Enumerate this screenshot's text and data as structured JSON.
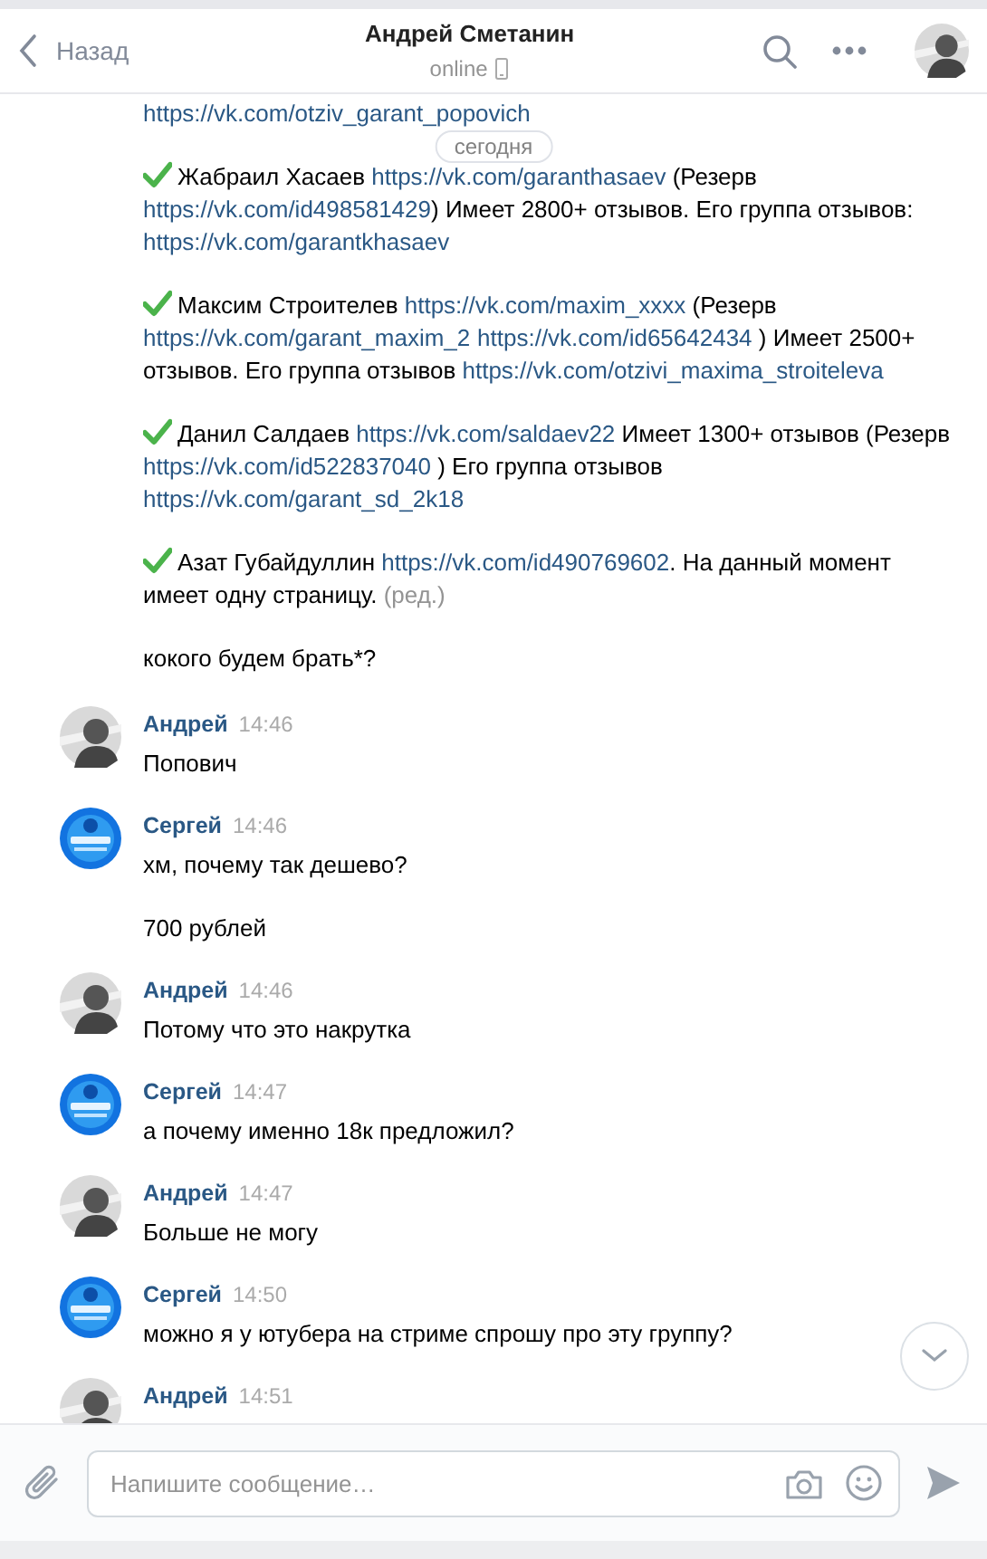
{
  "header": {
    "back_label": "Назад",
    "title": "Андрей Сметанин",
    "status": "online"
  },
  "date_divider": "сегодня",
  "messages": [
    {
      "paragraphs": [
        {
          "checked": false,
          "segments": [
            {
              "kind": "link",
              "text": "https://vk.com/otziv_garant_popovich"
            }
          ]
        },
        {
          "checked": true,
          "segments": [
            {
              "kind": "text",
              "text": "Жабраил Хасаев "
            },
            {
              "kind": "link",
              "text": "https://vk.com/garanthasaev"
            },
            {
              "kind": "text",
              "text": " (Резерв "
            },
            {
              "kind": "link",
              "text": "https://vk.com/id498581429"
            },
            {
              "kind": "text",
              "text": ") Имеет 2800+ отзывов. Его группа отзывов: "
            },
            {
              "kind": "link",
              "text": "https://vk.com/garantkhasaev"
            }
          ]
        },
        {
          "checked": true,
          "segments": [
            {
              "kind": "text",
              "text": "Максим Строителев "
            },
            {
              "kind": "link",
              "text": "https://vk.com/maxim_xxxx"
            },
            {
              "kind": "text",
              "text": " (Резерв "
            },
            {
              "kind": "link",
              "text": "https://vk.com/garant_maxim_2"
            },
            {
              "kind": "link",
              "text": "https://vk.com/id65642434"
            },
            {
              "kind": "text",
              "text": " ) Имеет 2500+ отзывов. Его группа отзывов "
            },
            {
              "kind": "link",
              "text": "https://vk.com/otzivi_maxima_stroiteleva"
            }
          ]
        },
        {
          "checked": true,
          "segments": [
            {
              "kind": "text",
              "text": "Данил Салдаев "
            },
            {
              "kind": "link",
              "text": "https://vk.com/saldaev22"
            },
            {
              "kind": "text",
              "text": " Имеет 1300+ отзывов (Резерв "
            },
            {
              "kind": "link",
              "text": "https://vk.com/id522837040"
            },
            {
              "kind": "text",
              "text": " ) Его группа отзывов "
            },
            {
              "kind": "link",
              "text": "https://vk.com/garant_sd_2k18"
            }
          ]
        },
        {
          "checked": true,
          "segments": [
            {
              "kind": "text",
              "text": "Азат Губайдуллин "
            },
            {
              "kind": "link",
              "text": "https://vk.com/id490769602"
            },
            {
              "kind": "text",
              "text": ". На данный момент имеет одну страницу. "
            },
            {
              "kind": "edited",
              "text": "(ред.)"
            }
          ]
        },
        {
          "checked": false,
          "segments": [
            {
              "kind": "text",
              "text": "кокого будем брать*?"
            }
          ]
        }
      ]
    },
    {
      "author": "Андрей",
      "time": "14:46",
      "kind": "person",
      "paragraphs": [
        {
          "checked": false,
          "segments": [
            {
              "kind": "text",
              "text": "Попович"
            }
          ]
        }
      ]
    },
    {
      "author": "Сергей",
      "time": "14:46",
      "kind": "emblem",
      "paragraphs": [
        {
          "checked": false,
          "segments": [
            {
              "kind": "text",
              "text": "хм, почему так дешево?"
            }
          ]
        },
        {
          "checked": false,
          "segments": [
            {
              "kind": "text",
              "text": "700 рублей"
            }
          ]
        }
      ]
    },
    {
      "author": "Андрей",
      "time": "14:46",
      "kind": "person",
      "paragraphs": [
        {
          "checked": false,
          "segments": [
            {
              "kind": "text",
              "text": "Потому что это накрутка"
            }
          ]
        }
      ]
    },
    {
      "author": "Сергей",
      "time": "14:47",
      "kind": "emblem",
      "paragraphs": [
        {
          "checked": false,
          "segments": [
            {
              "kind": "text",
              "text": "а почему именно 18к предложил?"
            }
          ]
        }
      ]
    },
    {
      "author": "Андрей",
      "time": "14:47",
      "kind": "person",
      "paragraphs": [
        {
          "checked": false,
          "segments": [
            {
              "kind": "text",
              "text": "Больше не могу"
            }
          ]
        }
      ]
    },
    {
      "author": "Сергей",
      "time": "14:50",
      "kind": "emblem",
      "paragraphs": [
        {
          "checked": false,
          "segments": [
            {
              "kind": "text",
              "text": "можно я у ютубера на стриме спрошу про эту группу?"
            }
          ]
        }
      ]
    },
    {
      "author": "Андрей",
      "time": "14:51",
      "kind": "person"
    }
  ],
  "composer": {
    "placeholder": "Напишите сообщение…"
  }
}
